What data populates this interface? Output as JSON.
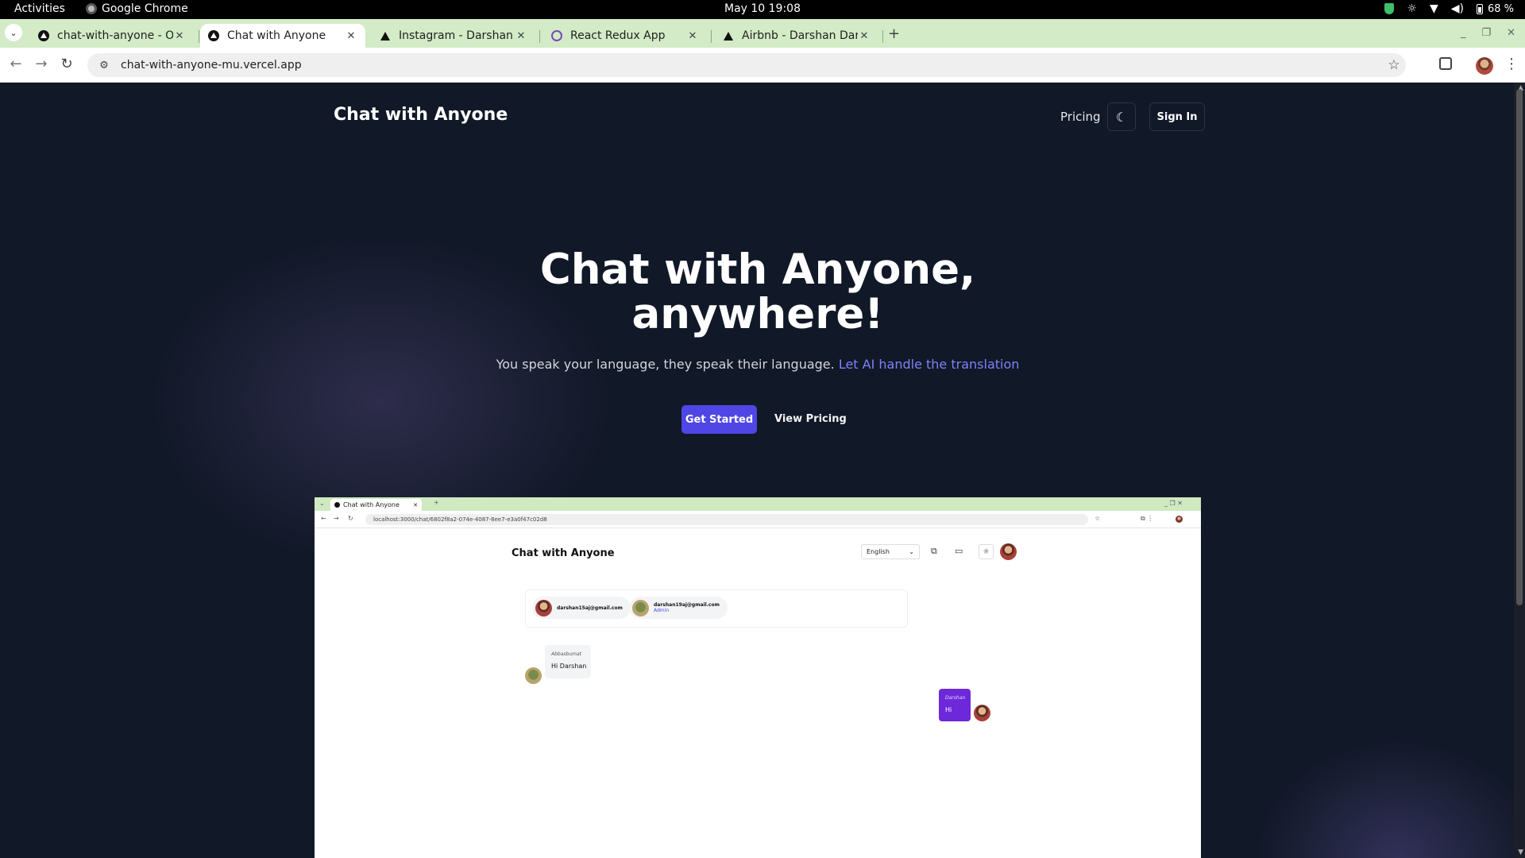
{
  "os": {
    "activities": "Activities",
    "app_name": "Google Chrome",
    "clock": "May 10  19:08",
    "battery": "68 %"
  },
  "browser": {
    "tabs": [
      {
        "title": "chat-with-anyone - Over",
        "icon": "vercel-icon",
        "active": false
      },
      {
        "title": "Chat with Anyone",
        "icon": "vercel-icon",
        "active": true
      },
      {
        "title": "Instagram - Darshan Dar",
        "icon": "vercel-triangle-icon",
        "active": false
      },
      {
        "title": "React Redux App",
        "icon": "redux-icon",
        "active": false
      },
      {
        "title": "Airbnb - Darshan Darshu",
        "icon": "vercel-triangle-icon",
        "active": false
      }
    ],
    "url": "chat-with-anyone-mu.vercel.app",
    "tabstrip_color": "#d3ebc6"
  },
  "site": {
    "logo": "Chat with Anyone",
    "nav_pricing": "Pricing",
    "sign_in": "Sign In",
    "hero_line1": "Chat with Anyone,",
    "hero_line2": "anywhere!",
    "subtitle_plain": "You speak your language, they speak their language. ",
    "subtitle_accent": "Let AI handle the translation",
    "cta_primary": "Get Started",
    "cta_secondary": "View Pricing",
    "colors": {
      "background": "#111827",
      "accent": "#4f46e5",
      "accent_text": "#7c83f7"
    }
  },
  "screenshot": {
    "tab_title": "Chat with Anyone",
    "url": "localhost:3000/chat/6802f8a2-074e-4087-8ee7-e3a0f47c02d8",
    "app_title": "Chat with Anyone",
    "language": "English",
    "participants": [
      {
        "email": "darshan15aj@gmail.com",
        "role": ""
      },
      {
        "email": "darshan19aj@gmail.com",
        "role": "Admin"
      }
    ],
    "messages": [
      {
        "sender": "Abbasbumat",
        "text": "Hi Darshan",
        "side": "left"
      },
      {
        "sender": "Darshan",
        "text": "Hi",
        "side": "right"
      }
    ]
  }
}
